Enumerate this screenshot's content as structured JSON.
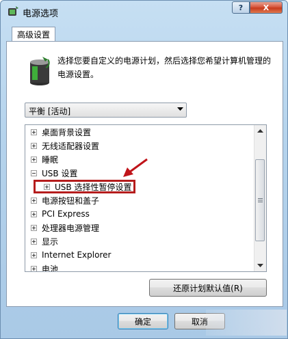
{
  "window": {
    "title": "电源选项",
    "help_label": "?",
    "close_label": "X"
  },
  "tab": {
    "label": "高级设置"
  },
  "description": "选择您要自定义的电源计划，然后选择您希望计算机管理的电源设置。",
  "plan_select": {
    "value": "平衡 [活动]"
  },
  "tree": {
    "items": [
      {
        "label": "桌面背景设置",
        "expanded": false
      },
      {
        "label": "无线适配器设置",
        "expanded": false
      },
      {
        "label": "睡眠",
        "expanded": false
      },
      {
        "label": "USB 设置",
        "expanded": true
      },
      {
        "label": "USB 选择性暂停设置",
        "expanded": false,
        "child": true,
        "highlighted": true
      },
      {
        "label": "电源按钮和盖子",
        "expanded": false
      },
      {
        "label": "PCI Express",
        "expanded": false
      },
      {
        "label": "处理器电源管理",
        "expanded": false
      },
      {
        "label": "显示",
        "expanded": false
      },
      {
        "label": "Internet Explorer",
        "expanded": false
      },
      {
        "label": "电池",
        "expanded": false
      }
    ]
  },
  "buttons": {
    "restore_label": "还原计划默认值(R)",
    "ok_label": "确定",
    "cancel_label": "取消"
  },
  "colors": {
    "highlight_border": "#b51c1c",
    "arrow": "#c0141a"
  }
}
